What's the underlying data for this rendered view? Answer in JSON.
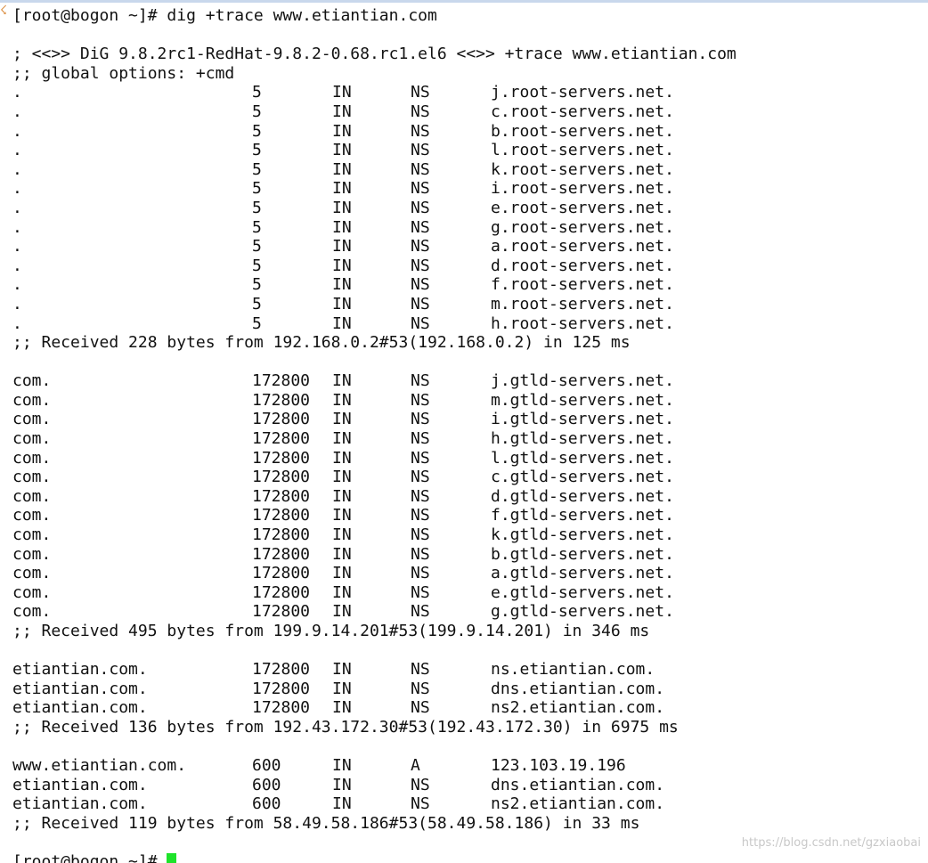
{
  "prompt1": "[root@bogon ~]# dig +trace www.etiantian.com",
  "header": {
    "version_line": "; <<>> DiG 9.8.2rc1-RedHat-9.8.2-0.68.rc1.el6 <<>> +trace www.etiantian.com",
    "options_line": ";; global options: +cmd"
  },
  "root_section": {
    "records": [
      {
        "name": ".",
        "ttl": "5",
        "cls": "IN",
        "type": "NS",
        "data": "j.root-servers.net."
      },
      {
        "name": ".",
        "ttl": "5",
        "cls": "IN",
        "type": "NS",
        "data": "c.root-servers.net."
      },
      {
        "name": ".",
        "ttl": "5",
        "cls": "IN",
        "type": "NS",
        "data": "b.root-servers.net."
      },
      {
        "name": ".",
        "ttl": "5",
        "cls": "IN",
        "type": "NS",
        "data": "l.root-servers.net."
      },
      {
        "name": ".",
        "ttl": "5",
        "cls": "IN",
        "type": "NS",
        "data": "k.root-servers.net."
      },
      {
        "name": ".",
        "ttl": "5",
        "cls": "IN",
        "type": "NS",
        "data": "i.root-servers.net."
      },
      {
        "name": ".",
        "ttl": "5",
        "cls": "IN",
        "type": "NS",
        "data": "e.root-servers.net."
      },
      {
        "name": ".",
        "ttl": "5",
        "cls": "IN",
        "type": "NS",
        "data": "g.root-servers.net."
      },
      {
        "name": ".",
        "ttl": "5",
        "cls": "IN",
        "type": "NS",
        "data": "a.root-servers.net."
      },
      {
        "name": ".",
        "ttl": "5",
        "cls": "IN",
        "type": "NS",
        "data": "d.root-servers.net."
      },
      {
        "name": ".",
        "ttl": "5",
        "cls": "IN",
        "type": "NS",
        "data": "f.root-servers.net."
      },
      {
        "name": ".",
        "ttl": "5",
        "cls": "IN",
        "type": "NS",
        "data": "m.root-servers.net."
      },
      {
        "name": ".",
        "ttl": "5",
        "cls": "IN",
        "type": "NS",
        "data": "h.root-servers.net."
      }
    ],
    "received": ";; Received 228 bytes from 192.168.0.2#53(192.168.0.2) in 125 ms"
  },
  "com_section": {
    "records": [
      {
        "name": "com.",
        "ttl": "172800",
        "cls": "IN",
        "type": "NS",
        "data": "j.gtld-servers.net."
      },
      {
        "name": "com.",
        "ttl": "172800",
        "cls": "IN",
        "type": "NS",
        "data": "m.gtld-servers.net."
      },
      {
        "name": "com.",
        "ttl": "172800",
        "cls": "IN",
        "type": "NS",
        "data": "i.gtld-servers.net."
      },
      {
        "name": "com.",
        "ttl": "172800",
        "cls": "IN",
        "type": "NS",
        "data": "h.gtld-servers.net."
      },
      {
        "name": "com.",
        "ttl": "172800",
        "cls": "IN",
        "type": "NS",
        "data": "l.gtld-servers.net."
      },
      {
        "name": "com.",
        "ttl": "172800",
        "cls": "IN",
        "type": "NS",
        "data": "c.gtld-servers.net."
      },
      {
        "name": "com.",
        "ttl": "172800",
        "cls": "IN",
        "type": "NS",
        "data": "d.gtld-servers.net."
      },
      {
        "name": "com.",
        "ttl": "172800",
        "cls": "IN",
        "type": "NS",
        "data": "f.gtld-servers.net."
      },
      {
        "name": "com.",
        "ttl": "172800",
        "cls": "IN",
        "type": "NS",
        "data": "k.gtld-servers.net."
      },
      {
        "name": "com.",
        "ttl": "172800",
        "cls": "IN",
        "type": "NS",
        "data": "b.gtld-servers.net."
      },
      {
        "name": "com.",
        "ttl": "172800",
        "cls": "IN",
        "type": "NS",
        "data": "a.gtld-servers.net."
      },
      {
        "name": "com.",
        "ttl": "172800",
        "cls": "IN",
        "type": "NS",
        "data": "e.gtld-servers.net."
      },
      {
        "name": "com.",
        "ttl": "172800",
        "cls": "IN",
        "type": "NS",
        "data": "g.gtld-servers.net."
      }
    ],
    "received": ";; Received 495 bytes from 199.9.14.201#53(199.9.14.201) in 346 ms"
  },
  "domain_section": {
    "records": [
      {
        "name": "etiantian.com.",
        "ttl": "172800",
        "cls": "IN",
        "type": "NS",
        "data": "ns.etiantian.com."
      },
      {
        "name": "etiantian.com.",
        "ttl": "172800",
        "cls": "IN",
        "type": "NS",
        "data": "dns.etiantian.com."
      },
      {
        "name": "etiantian.com.",
        "ttl": "172800",
        "cls": "IN",
        "type": "NS",
        "data": "ns2.etiantian.com."
      }
    ],
    "received": ";; Received 136 bytes from 192.43.172.30#53(192.43.172.30) in 6975 ms"
  },
  "answer_section": {
    "records": [
      {
        "name": "www.etiantian.com.",
        "ttl": "600",
        "cls": "IN",
        "type": "A",
        "data": "123.103.19.196"
      },
      {
        "name": "etiantian.com.",
        "ttl": "600",
        "cls": "IN",
        "type": "NS",
        "data": "dns.etiantian.com."
      },
      {
        "name": "etiantian.com.",
        "ttl": "600",
        "cls": "IN",
        "type": "NS",
        "data": "ns2.etiantian.com."
      }
    ],
    "received": ";; Received 119 bytes from 58.49.58.186#53(58.49.58.186) in 33 ms"
  },
  "prompt2": "[root@bogon ~]# ",
  "colors": {
    "background": "#ffffff",
    "text": "#111111",
    "cursor": "#1ee32a"
  },
  "watermark": "https://blog.csdn.net/gzxiaobai"
}
